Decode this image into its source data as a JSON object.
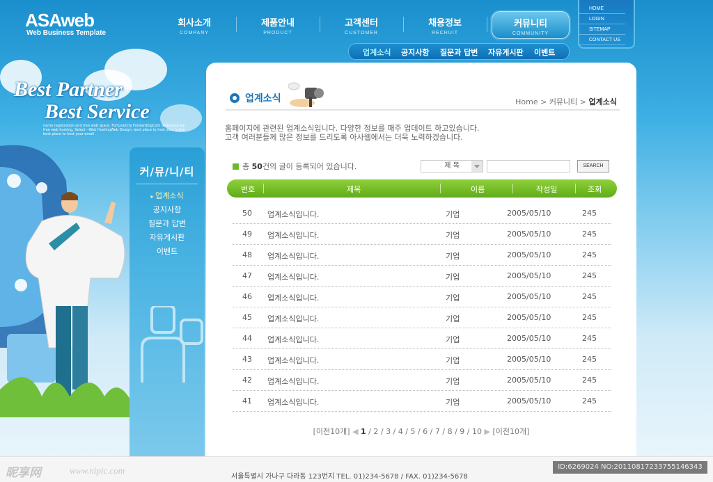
{
  "logo": {
    "title": "ASAweb",
    "subtitle": "Web Business Template"
  },
  "gnb": [
    {
      "ko": "회사소개",
      "en": "COMPANY"
    },
    {
      "ko": "제품안내",
      "en": "PRODUCT"
    },
    {
      "ko": "고객센터",
      "en": "CUSTOMER"
    },
    {
      "ko": "채용정보",
      "en": "RECRUIT"
    },
    {
      "ko": "커뮤니티",
      "en": "COMMUNITY"
    }
  ],
  "subnav": [
    "업계소식",
    "공지사항",
    "질문과 답변",
    "자유게시판",
    "이벤트"
  ],
  "util": [
    "HOME",
    "LOGIN",
    "SITEMAP",
    "CONTACT US"
  ],
  "slogan": {
    "line1": "Best Partner",
    "line2": "Best Service",
    "small": "name registration and free web space. FortuneCity ForwardingCom dedicated ad-free web hosting, Select --Web HostingWeb Design: best place to host your is the best place to host your email"
  },
  "sidebar": {
    "title": "커/뮤/니/티",
    "items": [
      "업계소식",
      "공지사항",
      "질문과 답변",
      "자유게시판",
      "이벤트"
    ]
  },
  "content": {
    "title": "업계소식",
    "breadcrumb": {
      "home": "Home",
      "sep1": ">",
      "parent": "커뮤니티",
      "sep2": ">",
      "current": "업계소식"
    },
    "desc1": "홈페이지에 관련된 업계소식입니다. 다양한 정보를 매주 업데이트 하고있습니다.",
    "desc2": "고객 여러분들께 많은 정보를 드리도록 아사웹에서는  더욱 노력하겠습니다.",
    "count_pre": "총 ",
    "count_num": "50",
    "count_post": "건의 글이 등록되어 있습니다.",
    "search_select": "제 목",
    "search_button": "SEARCH",
    "columns": [
      "번호",
      "제목",
      "이름",
      "작성일",
      "조회"
    ],
    "rows": [
      {
        "no": "50",
        "title": "업계소식입니다.",
        "name": "기업",
        "date": "2005/05/10",
        "views": "245"
      },
      {
        "no": "49",
        "title": "업계소식입니다.",
        "name": "기업",
        "date": "2005/05/10",
        "views": "245"
      },
      {
        "no": "48",
        "title": "업계소식입니다.",
        "name": "기업",
        "date": "2005/05/10",
        "views": "245"
      },
      {
        "no": "47",
        "title": "업계소식입니다.",
        "name": "기업",
        "date": "2005/05/10",
        "views": "245"
      },
      {
        "no": "46",
        "title": "업계소식입니다.",
        "name": "기업",
        "date": "2005/05/10",
        "views": "245"
      },
      {
        "no": "45",
        "title": "업계소식입니다.",
        "name": "기업",
        "date": "2005/05/10",
        "views": "245"
      },
      {
        "no": "44",
        "title": "업계소식입니다.",
        "name": "기업",
        "date": "2005/05/10",
        "views": "245"
      },
      {
        "no": "43",
        "title": "업계소식입니다.",
        "name": "기업",
        "date": "2005/05/10",
        "views": "245"
      },
      {
        "no": "42",
        "title": "업계소식입니다.",
        "name": "기업",
        "date": "2005/05/10",
        "views": "245"
      },
      {
        "no": "41",
        "title": "업계소식입니다.",
        "name": "기업",
        "date": "2005/05/10",
        "views": "245"
      }
    ],
    "paging": {
      "prev": "[이전10개]",
      "pages": [
        "1",
        "2",
        "3",
        "4",
        "5",
        "6",
        "7",
        "8",
        "9",
        "10"
      ],
      "next": "[이전10개]"
    }
  },
  "footer": {
    "address": "서울특별시 가나구 다라동 123번지 TEL. 01)234-5678  /  FAX. 01)234-5678",
    "watermark": "昵享网",
    "watermark_url": "www.nipic.com",
    "id_text": "ID:6269024 NO:20110817233755146343"
  },
  "colors": {
    "accent": "#1d76b8",
    "table_header": "#6cb82a",
    "sky": "#2a9fd6"
  }
}
